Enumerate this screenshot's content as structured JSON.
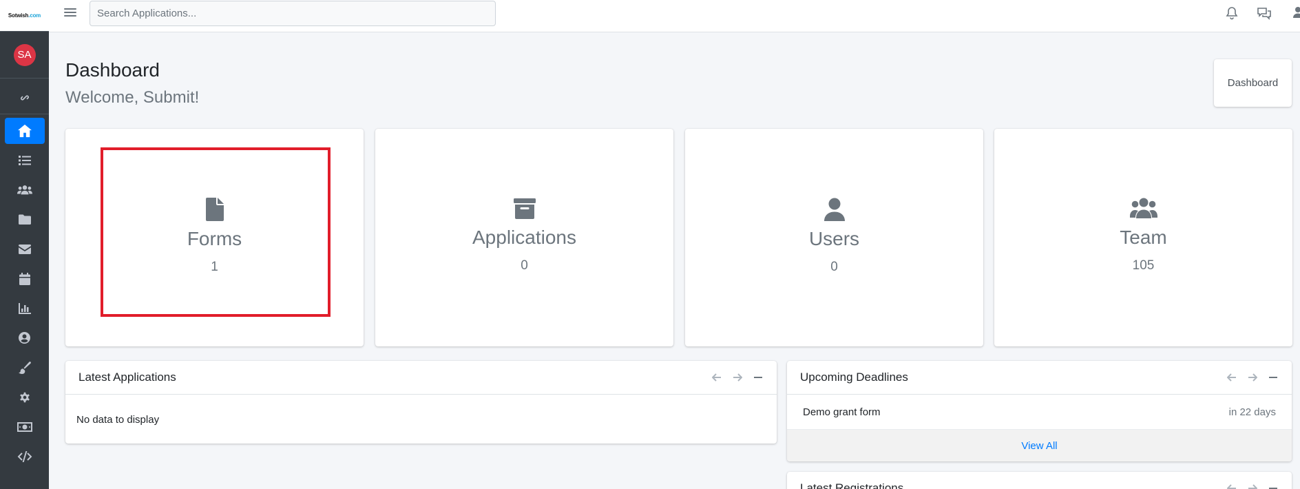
{
  "sidebar": {
    "brand": {
      "text": "Sotwish",
      "accent": ".com"
    },
    "avatar_initials": "SA",
    "items": [
      {
        "icon": "link-icon"
      },
      {
        "icon": "home-icon",
        "active": true
      },
      {
        "icon": "list-icon"
      },
      {
        "icon": "users-icon"
      },
      {
        "icon": "folder-icon"
      },
      {
        "icon": "envelope-icon"
      },
      {
        "icon": "calendar-icon"
      },
      {
        "icon": "chart-bar-icon"
      },
      {
        "icon": "user-circle-icon"
      },
      {
        "icon": "paint-brush-icon"
      },
      {
        "icon": "gear-icon"
      },
      {
        "icon": "money-bill-icon"
      },
      {
        "icon": "code-icon"
      }
    ]
  },
  "topbar": {
    "search_placeholder": "Search Applications...",
    "icons": [
      "bell-icon",
      "chat-icon",
      "user-icon"
    ]
  },
  "header": {
    "title": "Dashboard",
    "subtitle": "Welcome, Submit!",
    "breadcrumb": "Dashboard"
  },
  "stats": [
    {
      "label": "Forms",
      "value": "1",
      "icon": "file-icon"
    },
    {
      "label": "Applications",
      "value": "0",
      "icon": "archive-icon"
    },
    {
      "label": "Users",
      "value": "0",
      "icon": "user-icon"
    },
    {
      "label": "Team",
      "value": "105",
      "icon": "users-icon"
    }
  ],
  "latest_applications": {
    "title": "Latest Applications",
    "empty_text": "No data to display"
  },
  "upcoming_deadlines": {
    "title": "Upcoming Deadlines",
    "rows": [
      {
        "name": "Demo grant form",
        "when": "in 22 days"
      }
    ],
    "view_all": "View All"
  },
  "latest_registrations": {
    "title": "Latest Registrations"
  },
  "colors": {
    "sidebar_bg": "#343a40",
    "active_nav": "#007bff",
    "avatar_bg": "#dc3545",
    "highlight": "#e11d2a",
    "link": "#007bff"
  }
}
